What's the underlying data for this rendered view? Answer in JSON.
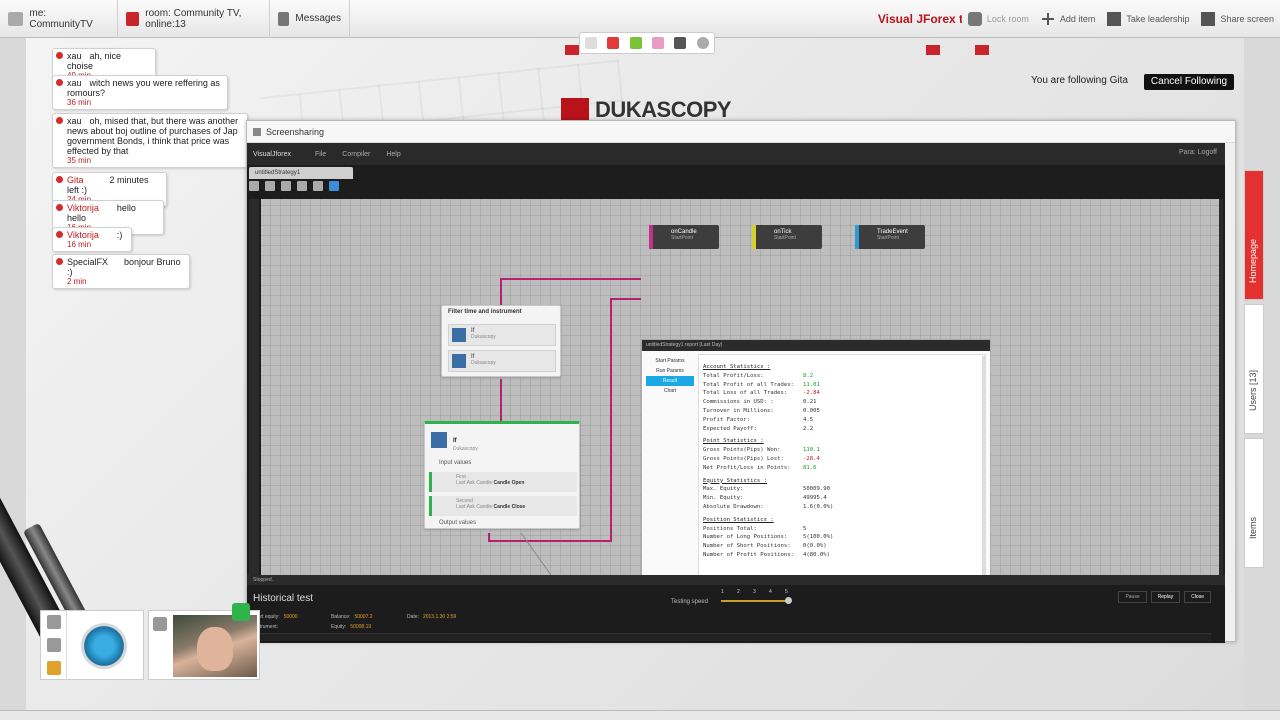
{
  "topbar": {
    "me_label": "me: CommunityTV",
    "room_label": "room: Community TV, online:13",
    "messages_label": "Messages",
    "brand": "Visual JForex tu",
    "lock_room": "Lock room",
    "add_item": "Add item",
    "take_leadership": "Take leadership",
    "share_screen": "Share screen"
  },
  "follow": {
    "text": "You are following Gita",
    "cancel_label": "Cancel Following"
  },
  "logo_text": "DUKASCOPY",
  "chat": [
    {
      "user": "xau",
      "text": "ah, nice choise",
      "time": "49 min",
      "red": false
    },
    {
      "user": "xau",
      "text": "witch news you were reffering as romours?",
      "time": "36 min",
      "red": false
    },
    {
      "user": "xau",
      "text": "oh, mised that, but there was another news about boj outline of purchases of Jap government Bonds, i think that price was effected by that",
      "time": "35 min",
      "red": false
    },
    {
      "user": "Gita",
      "text": "2 minutes left :)",
      "time": "24 min",
      "red": true
    },
    {
      "user": "Viktorija",
      "text": "hello hello",
      "time": "16 min",
      "red": true
    },
    {
      "user": "Viktorija",
      "text": ":)",
      "time": "16 min",
      "red": true
    },
    {
      "user": "SpecialFX",
      "text": "bonjour Bruno :)",
      "time": "2 min",
      "red": false
    }
  ],
  "screenshare": {
    "title": "Screensharing",
    "app_name": "VisualJforex",
    "menu": [
      "File",
      "Compiler",
      "Help"
    ],
    "menu_right": "Para: Logoff",
    "tab": "untitledStrategy1",
    "start_blocks": [
      {
        "name": "onCandle",
        "sub": "StartPoint",
        "color": "#c2308f"
      },
      {
        "name": "onTick",
        "sub": "StartPoint",
        "color": "#d8cf2b"
      },
      {
        "name": "TradeEvent",
        "sub": "StartPoint",
        "color": "#2b9bd8"
      }
    ],
    "node1": {
      "title": "Filter time and instrument",
      "rows": [
        {
          "label": "If",
          "sub": "Dukascopy"
        },
        {
          "label": "If",
          "sub": "Dukascopy"
        }
      ]
    },
    "node2": {
      "title": "If",
      "sub": "Dukascopy",
      "section_in": "Input values",
      "rows": [
        {
          "label": "First",
          "sub": "Last Ask Candle",
          "bold": "Candle Open"
        },
        {
          "label": "Second",
          "sub": "Last Ask Candle",
          "bold": "Candle Close"
        }
      ],
      "section_out": "Output values"
    },
    "report": {
      "title": "untitledStrategy1 report (Last Day)",
      "menu": [
        "Start Params",
        "Run Params",
        "Result",
        "Chart"
      ],
      "active": "Result",
      "sections": [
        {
          "title": "Account Statistics :",
          "rows": [
            {
              "label": "Total Profit/Loss:",
              "value": "8.2",
              "c": "g"
            },
            {
              "label": "Total Profit of all Trades:",
              "value": "11.01",
              "c": "g"
            },
            {
              "label": "Total Loss of all Trades:",
              "value": "-2.84",
              "c": "r"
            },
            {
              "label": "Commissions in USD: :",
              "value": "0.21",
              "c": ""
            },
            {
              "label": "Turnover in Millions:",
              "value": "0.005",
              "c": ""
            },
            {
              "label": "Profit Factor:",
              "value": "4.5",
              "c": ""
            },
            {
              "label": "Expected Payoff:",
              "value": "2.2",
              "c": ""
            }
          ]
        },
        {
          "title": "Point Statistics :",
          "rows": [
            {
              "label": "Gross Points(Pips) Won:",
              "value": "110.1",
              "c": "g"
            },
            {
              "label": "Gross Points(Pips) Lost:",
              "value": "-28.4",
              "c": "r"
            },
            {
              "label": "Net Profit/Loss in Points:",
              "value": "81.6",
              "c": "g"
            }
          ]
        },
        {
          "title": "Equity Statistics :",
          "rows": [
            {
              "label": "Max. Equity:",
              "value": "50009.90",
              "c": ""
            },
            {
              "label": "Min. Equity:",
              "value": "49995.4",
              "c": ""
            },
            {
              "label": "Absolute Drawdown:",
              "value": "1.6(0.0%)",
              "c": ""
            }
          ]
        },
        {
          "title": "Position Statistics :",
          "rows": [
            {
              "label": "Positions Total:",
              "value": "5",
              "c": ""
            },
            {
              "label": "Number of Long Positions:",
              "value": "5(100.0%)",
              "c": ""
            },
            {
              "label": "Number of Short Positions:",
              "value": "0(0.0%)",
              "c": ""
            },
            {
              "label": "Number of Profit Positions:",
              "value": "4(80.0%)",
              "c": ""
            }
          ]
        }
      ]
    },
    "status": "Stopped.",
    "hist": {
      "title": "Historical test",
      "speed_label": "Testing speed",
      "speed_ticks": [
        "1",
        "2",
        "3",
        "4",
        "5"
      ],
      "speed_value": 5,
      "btn_pause": "Pause",
      "btn_replay": "Replay",
      "btn_close": "Close",
      "start_equity_label": "Start equity:",
      "start_equity": "50000",
      "instrument_label": "Instrument:",
      "balance_label": "Balance:",
      "balance": "50007.2",
      "equity_label": "Equity:",
      "equity": "50008.19",
      "date_label": "Date:",
      "date": "2013.1.30 2:59"
    }
  },
  "right_tabs": {
    "homepage": "Homepage",
    "users": "Users [13]",
    "items": "Items"
  },
  "colors": {
    "accent_red": "#c9232c",
    "brand_red": "#b8121b",
    "report_active": "#1aa9e4"
  }
}
